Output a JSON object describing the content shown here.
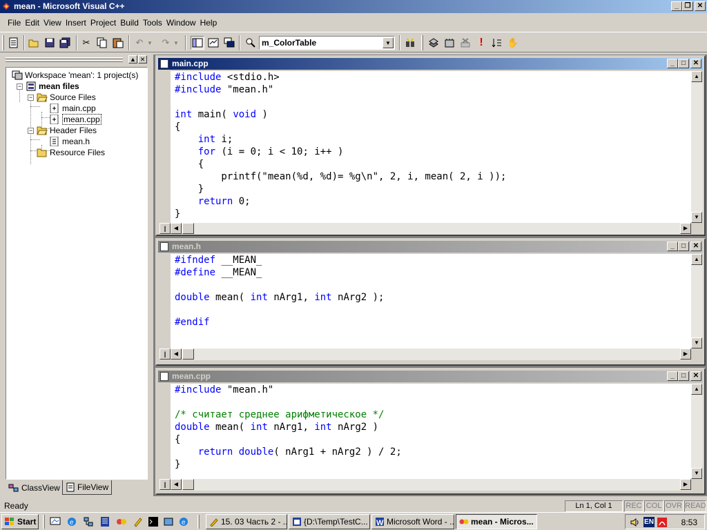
{
  "window": {
    "title": "mean - Microsoft Visual C++",
    "controls": {
      "minimize": "_",
      "maximize": "❐",
      "close": "✕"
    }
  },
  "menu": [
    "File",
    "Edit",
    "View",
    "Insert",
    "Project",
    "Build",
    "Tools",
    "Window",
    "Help"
  ],
  "toolbar": {
    "combo_value": "m_ColorTable"
  },
  "workspace": {
    "root": "Workspace 'mean': 1 project(s)",
    "project": "mean files",
    "folders": [
      {
        "label": "Source Files",
        "files": [
          "main.cpp",
          "mean.cpp"
        ]
      },
      {
        "label": "Header Files",
        "files": [
          "mean.h"
        ]
      },
      {
        "label": "Resource Files",
        "files": []
      }
    ],
    "tabs": [
      "ClassView",
      "FileView"
    ],
    "active_tab": "FileView",
    "selected_file": "mean.cpp"
  },
  "documents": [
    {
      "title": "main.cpp",
      "active": true,
      "lines": [
        "#include <stdio.h>",
        "#include \"mean.h\"",
        "",
        "int main( void )",
        "{",
        "    int i;",
        "    for (i = 0; i < 10; i++ )",
        "    {",
        "        printf(\"mean(%d, %d)= %g\\n\", 2, i, mean( 2, i ));",
        "    }",
        "    return 0;",
        "}"
      ]
    },
    {
      "title": "mean.h",
      "active": false,
      "lines": [
        "#ifndef __MEAN_",
        "#define __MEAN_",
        "",
        "double mean( int nArg1, int nArg2 );",
        "",
        "#endif"
      ]
    },
    {
      "title": "mean.cpp",
      "active": false,
      "lines": [
        "#include \"mean.h\"",
        "",
        "/* считает среднее арифметическое */",
        "double mean( int nArg1, int nArg2 )",
        "{",
        "    return double( nArg1 + nArg2 ) / 2;",
        "}"
      ]
    }
  ],
  "keywords": [
    "#include",
    "#ifndef",
    "#define",
    "#endif",
    "int",
    "void",
    "for",
    "return",
    "double"
  ],
  "statusbar": {
    "text": "Ready",
    "position": "Ln 1, Col 1",
    "indicators": [
      "REC",
      "COL",
      "OVR",
      "READ"
    ]
  },
  "taskbar": {
    "start": "Start",
    "tasks": [
      {
        "label": "15. 03 Часть 2 - ...",
        "active": false
      },
      {
        "label": "{D:\\Temp\\TestC...",
        "active": false
      },
      {
        "label": "Microsoft Word - ...",
        "active": false
      },
      {
        "label": "mean - Micros...",
        "active": true
      }
    ],
    "language": "EN",
    "clock": "8:53"
  },
  "colors": {
    "keyword": "#0000ff",
    "comment": "#008000",
    "title_active": "#0a246a",
    "face": "#d4d0c8"
  }
}
